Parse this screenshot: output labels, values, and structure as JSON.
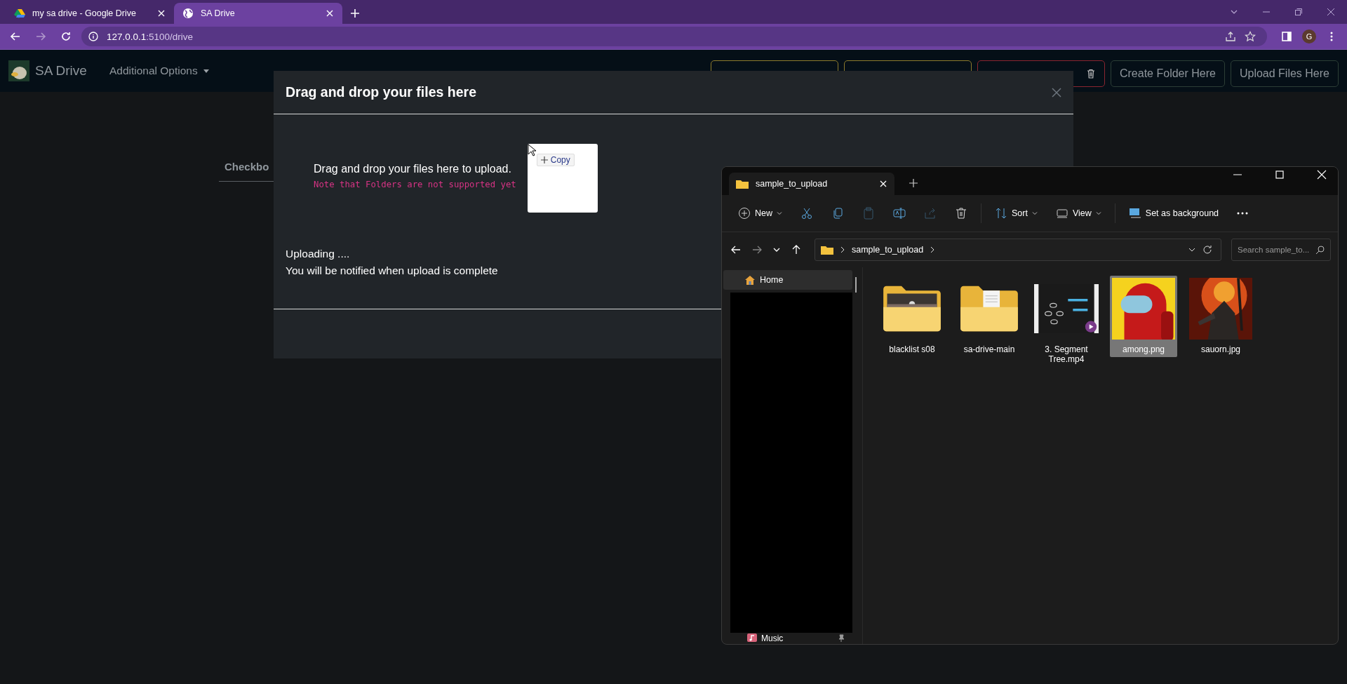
{
  "browser": {
    "tabs": [
      {
        "title": "my sa drive - Google Drive",
        "kind": "drive",
        "selected": false
      },
      {
        "title": "SA Drive",
        "kind": "globe",
        "selected": true
      }
    ],
    "url_host": "127.0.0.1",
    "url_path": ":5100/drive",
    "profile_initial": "G"
  },
  "navbar": {
    "brand": "SA Drive",
    "menu": "Additional Options",
    "buttons": [
      {
        "color": "#8c7a2c"
      },
      {
        "color": "#8c7a2c"
      },
      {
        "color": "#8a2530",
        "kind": "trash"
      },
      {
        "color": "#2c3e36",
        "label": "Create Folder Here"
      },
      {
        "color": "#2c3e36",
        "label": "Upload Files Here"
      }
    ]
  },
  "page": {
    "tab_label": "Checkbo"
  },
  "modal": {
    "title": "Drag and drop your files here",
    "drop_text": "Drag and drop your files here to upload.",
    "note": "Note that Folders are not supported yet",
    "drag_badge": "Copy",
    "status": [
      "Uploading ....",
      "You will be notified when upload is complete"
    ]
  },
  "explorer": {
    "tab": "sample_to_upload",
    "toolbar": [
      {
        "kind": "new",
        "label": "New",
        "disabled": false
      },
      {
        "kind": "cut",
        "disabled": false
      },
      {
        "kind": "copy",
        "disabled": false
      },
      {
        "kind": "paste",
        "disabled": true
      },
      {
        "kind": "rename",
        "disabled": false
      },
      {
        "kind": "share",
        "disabled": true
      },
      {
        "kind": "delete",
        "disabled": false
      },
      {
        "kind": "sort",
        "label": "Sort",
        "disabled": false
      },
      {
        "kind": "view",
        "label": "View",
        "disabled": false
      },
      {
        "kind": "background",
        "label": "Set as background",
        "disabled": false
      },
      {
        "kind": "more",
        "disabled": false
      }
    ],
    "path": "sample_to_upload",
    "search": {
      "placeholder": "Search sample_to..."
    },
    "nav": [
      {
        "label": "Home",
        "selected": true
      }
    ],
    "nav_bottom": "Music",
    "files": [
      {
        "name": "blacklist s08",
        "kind": "folder-photo",
        "selected": false
      },
      {
        "name": "sa-drive-main",
        "kind": "folder-doc",
        "selected": false
      },
      {
        "name": "3. Segment Tree.mp4",
        "kind": "video",
        "selected": false
      },
      {
        "name": "among.png",
        "kind": "image-yellow",
        "selected": true
      },
      {
        "name": "sauorn.jpg",
        "kind": "image-fire",
        "selected": false
      }
    ]
  }
}
